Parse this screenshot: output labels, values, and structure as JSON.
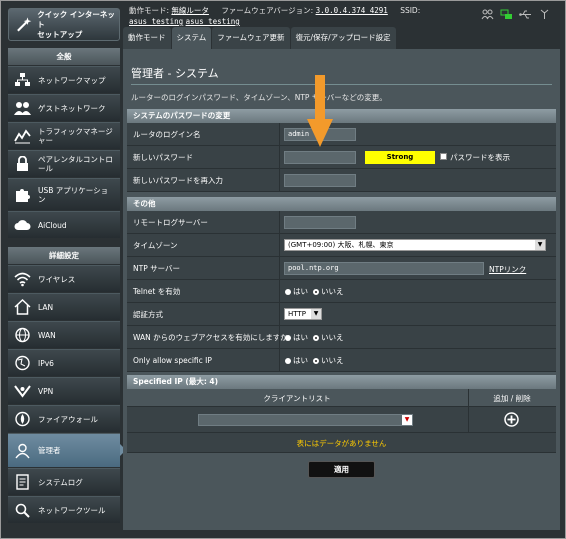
{
  "quick_setup": {
    "label": "クイック インターネット\nセットアップ"
  },
  "top_info": {
    "mode_label": "動作モード:",
    "mode_value": "無線ルータ",
    "fw_label": "ファームウェアバージョン:",
    "fw_value": "3.0.0.4.374_4291",
    "ssid_label": "SSID:",
    "ssid_1": "asus_testing",
    "ssid_2": "asus_testing"
  },
  "top_icons": [
    "users-icon",
    "network-icon",
    "usb-icon",
    "signal-icon"
  ],
  "tabs": [
    {
      "label": "動作モード"
    },
    {
      "label": "システム"
    },
    {
      "label": "ファームウェア更新"
    },
    {
      "label": "復元/保存/アップロード設定"
    }
  ],
  "sidebar": {
    "general_header": "全般",
    "general_items": [
      {
        "label": "ネットワークマップ",
        "icon": "network-map-icon"
      },
      {
        "label": "ゲストネットワーク",
        "icon": "guest-network-icon"
      },
      {
        "label": "トラフィックマネージ\nャー",
        "icon": "traffic-manager-icon"
      },
      {
        "label": "ペアレンタルコントロ\nール",
        "icon": "parental-control-icon"
      },
      {
        "label": "USB アプリケーショ\nン",
        "icon": "usb-application-icon"
      },
      {
        "label": "AiCloud",
        "icon": "aicloud-icon"
      }
    ],
    "advanced_header": "詳細設定",
    "advanced_items": [
      {
        "label": "ワイヤレス",
        "icon": "wireless-icon"
      },
      {
        "label": "LAN",
        "icon": "lan-icon"
      },
      {
        "label": "WAN",
        "icon": "wan-icon"
      },
      {
        "label": "IPv6",
        "icon": "ipv6-icon"
      },
      {
        "label": "VPN",
        "icon": "vpn-icon"
      },
      {
        "label": "ファイアウォール",
        "icon": "firewall-icon"
      },
      {
        "label": "管理者",
        "icon": "administration-icon"
      },
      {
        "label": "システムログ",
        "icon": "system-log-icon"
      },
      {
        "label": "ネットワークツール",
        "icon": "network-tools-icon"
      }
    ]
  },
  "main": {
    "title": "管理者 - システム",
    "description": "ルーターのログインパスワード、タイムゾーン、NTP サーバーなどの変更。",
    "password_section": {
      "header": "システムのパスワードの変更",
      "login_name_label": "ルータのログイン名",
      "login_name_value": "admin",
      "new_password_label": "新しいパスワード",
      "strength": "Strong",
      "show_password_label": "パスワードを表示",
      "confirm_password_label": "新しいパスワードを再入力"
    },
    "misc_section": {
      "header": "その他",
      "remote_log_label": "リモートログサーバー",
      "timezone_label": "タイムゾーン",
      "timezone_value": "(GMT+09:00) 大阪、札幌、東京",
      "ntp_label": "NTP サーバー",
      "ntp_value": "pool.ntp.org",
      "ntp_link": "NTPリンク",
      "telnet_label": "Telnet を有効",
      "auth_label": "認証方式",
      "auth_value": "HTTP",
      "wan_access_label": "WAN からのウェブアクセスを有効にしますか",
      "specific_ip_label": "Only allow specific IP",
      "yes": "はい",
      "no": "いいえ"
    },
    "specified_ip": {
      "header": "Specified IP (最大: 4)",
      "col_client": "クライアントリスト",
      "col_action": "追加 / 削除",
      "empty": "表にはデータがありません"
    },
    "apply_label": "適用"
  },
  "colors": {
    "strength": "#ffff00",
    "arrow": "#f39a2b",
    "empty_text": "#ffcc00",
    "link": "#ffffff"
  }
}
